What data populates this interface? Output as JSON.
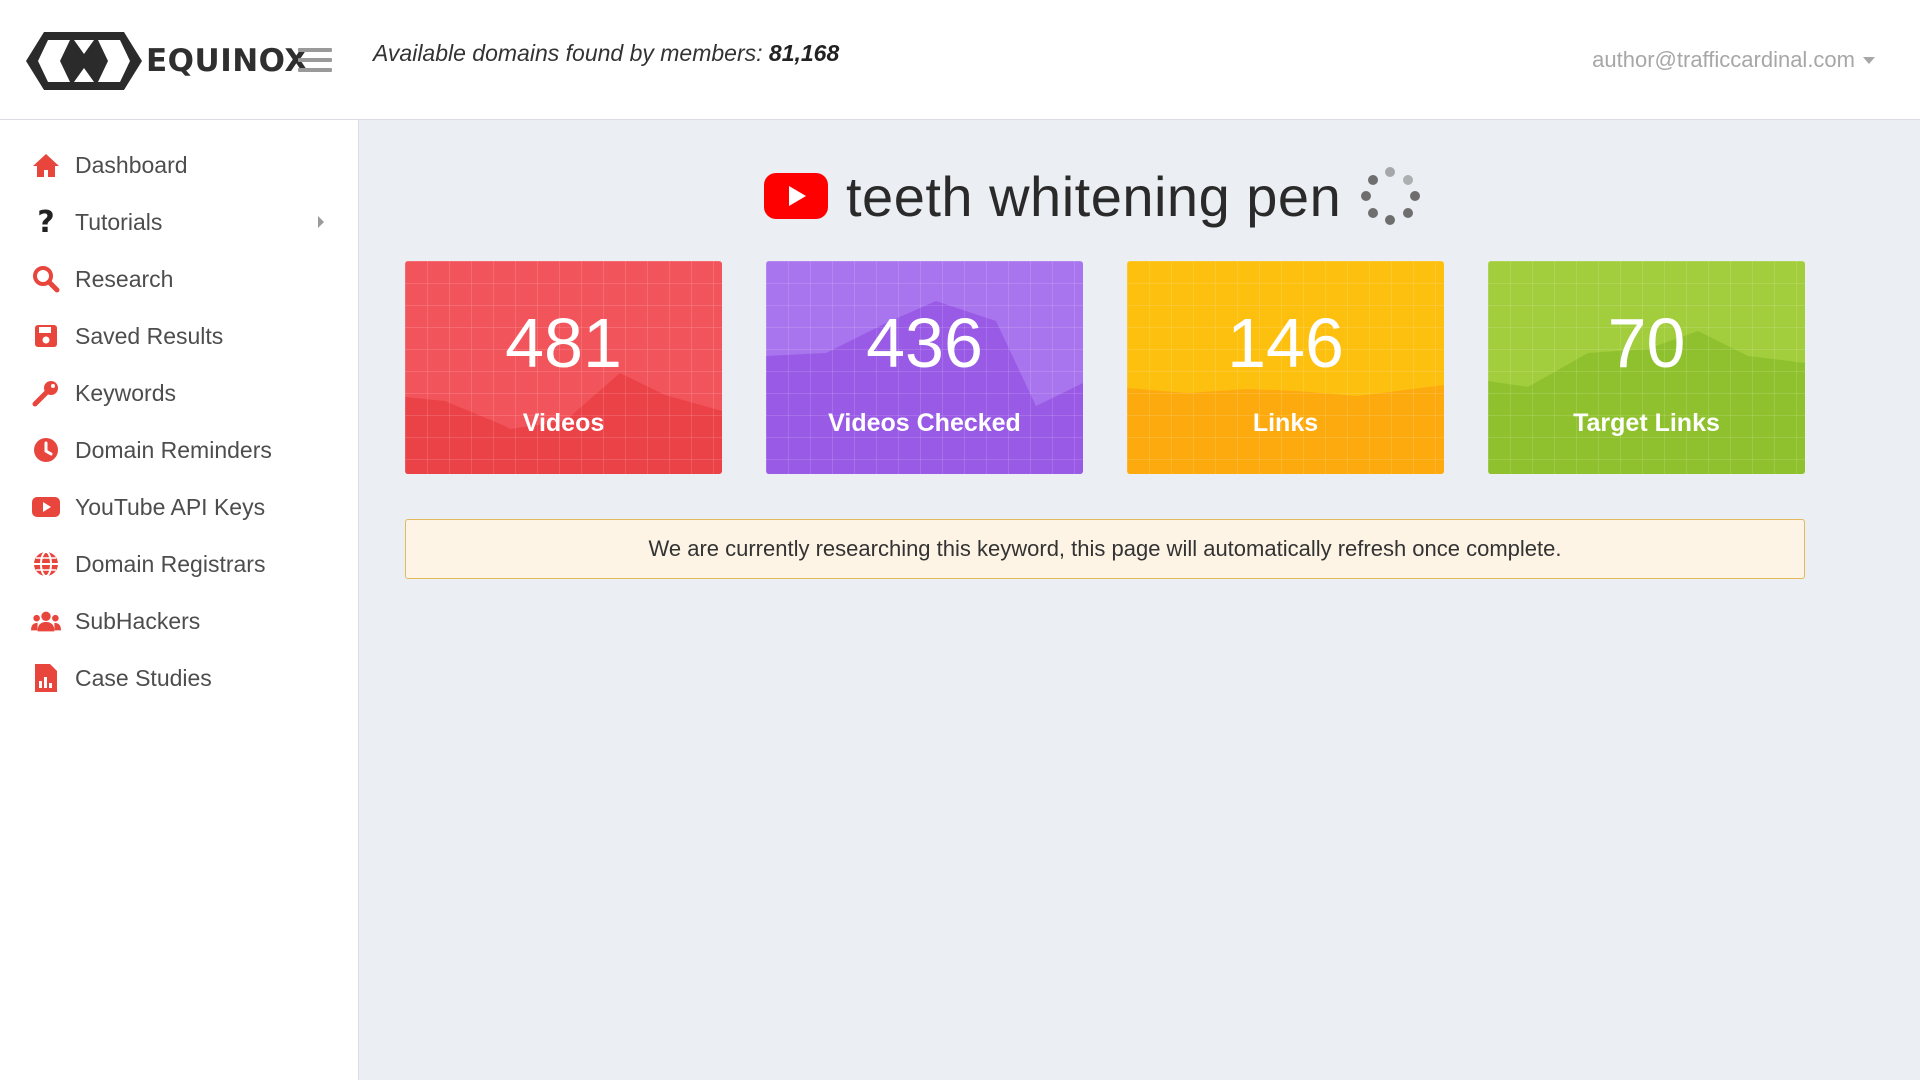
{
  "header": {
    "brand": "EQUINOX",
    "avail_prefix": "Available domains found by members: ",
    "avail_count": "81,168",
    "user_email": "author@trafficcardinal.com"
  },
  "sidebar": {
    "accent_color": "#e8453c",
    "items": [
      {
        "label": "Dashboard",
        "icon": "home-icon"
      },
      {
        "label": "Tutorials",
        "icon": "question-icon",
        "has_submenu": true
      },
      {
        "label": "Research",
        "icon": "search-icon"
      },
      {
        "label": "Saved Results",
        "icon": "save-icon"
      },
      {
        "label": "Keywords",
        "icon": "key-icon"
      },
      {
        "label": "Domain Reminders",
        "icon": "clock-icon"
      },
      {
        "label": "YouTube API Keys",
        "icon": "youtube-icon"
      },
      {
        "label": "Domain Registrars",
        "icon": "globe-icon"
      },
      {
        "label": "SubHackers",
        "icon": "users-icon"
      },
      {
        "label": "Case Studies",
        "icon": "report-icon"
      }
    ]
  },
  "main": {
    "keyword": "teeth whitening pen",
    "stats": [
      {
        "value": "481",
        "label": "Videos",
        "color": "#f2545b"
      },
      {
        "value": "436",
        "label": "Videos Checked",
        "color": "#a462ec"
      },
      {
        "value": "146",
        "label": "Links",
        "color": "#fbb80e"
      },
      {
        "value": "70",
        "label": "Target Links",
        "color": "#98c93c"
      }
    ],
    "notice": "We are currently researching this keyword, this page will automatically refresh once complete."
  }
}
